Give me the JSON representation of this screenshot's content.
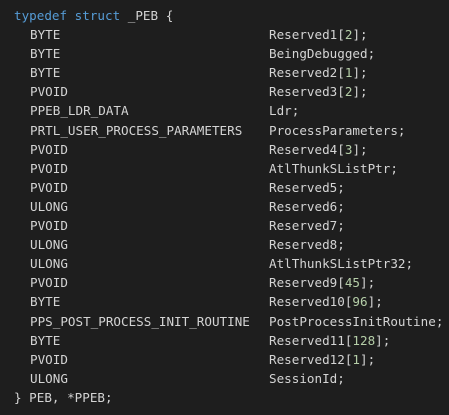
{
  "code": {
    "header": {
      "typedef": "typedef",
      "struct": "struct",
      "name": "_PEB",
      "brace": "{"
    },
    "fields": [
      {
        "type": "BYTE",
        "name": "Reserved1",
        "dim": "2"
      },
      {
        "type": "BYTE",
        "name": "BeingDebugged",
        "dim": null
      },
      {
        "type": "BYTE",
        "name": "Reserved2",
        "dim": "1"
      },
      {
        "type": "PVOID",
        "name": "Reserved3",
        "dim": "2"
      },
      {
        "type": "PPEB_LDR_DATA",
        "name": "Ldr",
        "dim": null
      },
      {
        "type": "PRTL_USER_PROCESS_PARAMETERS",
        "name": "ProcessParameters",
        "dim": null
      },
      {
        "type": "PVOID",
        "name": "Reserved4",
        "dim": "3"
      },
      {
        "type": "PVOID",
        "name": "AtlThunkSListPtr",
        "dim": null
      },
      {
        "type": "PVOID",
        "name": "Reserved5",
        "dim": null
      },
      {
        "type": "ULONG",
        "name": "Reserved6",
        "dim": null
      },
      {
        "type": "PVOID",
        "name": "Reserved7",
        "dim": null
      },
      {
        "type": "ULONG",
        "name": "Reserved8",
        "dim": null
      },
      {
        "type": "ULONG",
        "name": "AtlThunkSListPtr32",
        "dim": null
      },
      {
        "type": "PVOID",
        "name": "Reserved9",
        "dim": "45"
      },
      {
        "type": "BYTE",
        "name": "Reserved10",
        "dim": "96"
      },
      {
        "type": "PPS_POST_PROCESS_INIT_ROUTINE",
        "name": "PostProcessInitRoutine",
        "dim": null
      },
      {
        "type": "BYTE",
        "name": "Reserved11",
        "dim": "128"
      },
      {
        "type": "PVOID",
        "name": "Reserved12",
        "dim": "1"
      },
      {
        "type": "ULONG",
        "name": "SessionId",
        "dim": null
      }
    ],
    "footer": "} PEB, *PPEB;",
    "colors": {
      "background": "#1e1e1e",
      "keyword": "#569cd6",
      "text": "#d4d4d4",
      "number": "#b5cea8"
    }
  }
}
